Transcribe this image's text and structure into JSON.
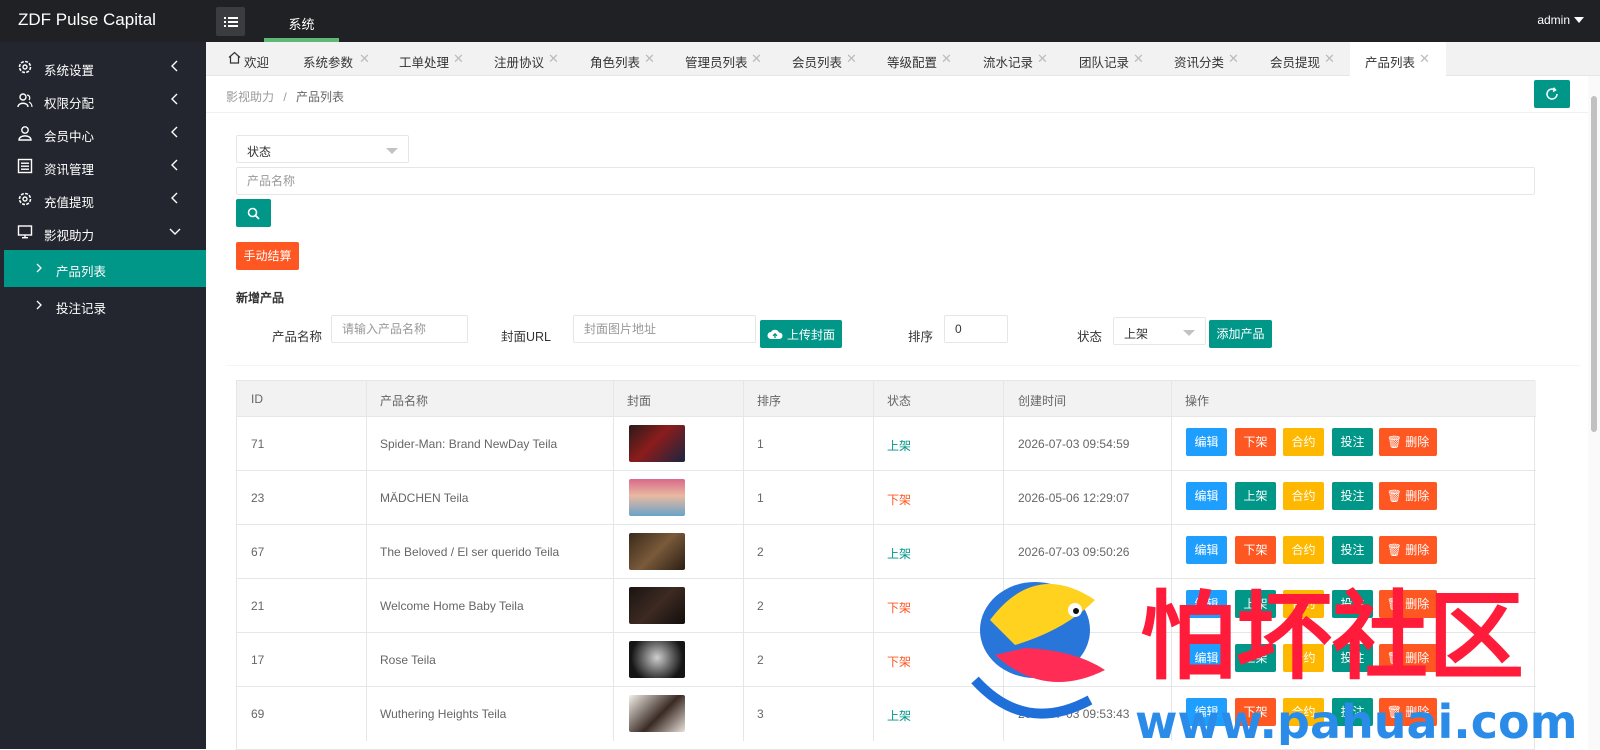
{
  "app": {
    "brand": "ZDF Pulse Capital",
    "top_tab": "系统",
    "user": "admin"
  },
  "sidebar": {
    "items": [
      {
        "label": "系统设置",
        "icon": "gear-icon"
      },
      {
        "label": "权限分配",
        "icon": "users-icon"
      },
      {
        "label": "会员中心",
        "icon": "user-icon"
      },
      {
        "label": "资讯管理",
        "icon": "list-icon"
      },
      {
        "label": "充值提现",
        "icon": "gear-icon"
      },
      {
        "label": "影视助力",
        "icon": "monitor-icon"
      }
    ],
    "sub_items": [
      {
        "label": "产品列表",
        "active": true
      },
      {
        "label": "投注记录",
        "active": false
      }
    ]
  },
  "tabs": [
    "欢迎",
    "系统参数",
    "工单处理",
    "注册协议",
    "角色列表",
    "管理员列表",
    "会员列表",
    "等级配置",
    "流水记录",
    "团队记录",
    "资讯分类",
    "会员提现",
    "产品列表"
  ],
  "breadcrumb": {
    "parent": "影视助力",
    "sep": "/",
    "current": "产品列表"
  },
  "filters": {
    "status_label": "状态",
    "name_placeholder": "产品名称",
    "settle_label": "手动结算"
  },
  "add_form": {
    "title": "新增产品",
    "name_label": "产品名称",
    "name_placeholder": "请输入产品名称",
    "cover_label": "封面URL",
    "cover_placeholder": "封面图片地址",
    "upload_label": "上传封面",
    "sort_label": "排序",
    "sort_value": "0",
    "status_label": "状态",
    "status_value": "上架",
    "add_label": "添加产品"
  },
  "table": {
    "headers": [
      "ID",
      "产品名称",
      "封面",
      "排序",
      "状态",
      "创建时间",
      "操作"
    ],
    "rows": [
      {
        "id": "71",
        "name": "Spider-Man: Brand NewDay Teila",
        "sort": "1",
        "status": "上架",
        "created": "2026-07-03 09:54:59",
        "toggle": "下架"
      },
      {
        "id": "23",
        "name": "MÄDCHEN Teila",
        "sort": "1",
        "status": "下架",
        "created": "2026-05-06 12:29:07",
        "toggle": "上架"
      },
      {
        "id": "67",
        "name": "The Beloved / El ser querido Teila",
        "sort": "2",
        "status": "上架",
        "created": "2026-07-03 09:50:26",
        "toggle": "下架"
      },
      {
        "id": "21",
        "name": "Welcome Home Baby Teila",
        "sort": "2",
        "status": "下架",
        "created": "",
        "toggle": "上架"
      },
      {
        "id": "17",
        "name": "Rose Teila",
        "sort": "2",
        "status": "下架",
        "created": "20... 09",
        "toggle": "上架"
      },
      {
        "id": "69",
        "name": "Wuthering Heights Teila",
        "sort": "3",
        "status": "上架",
        "created": "2026-07-03 09:53:43",
        "toggle": "下架"
      }
    ],
    "actions": {
      "edit": "编辑",
      "contract": "合约",
      "bet": "投注",
      "delete": "删除"
    }
  },
  "watermark": {
    "title": "怕坏社区",
    "url": "www.pahuai.com"
  },
  "colors": {
    "primary": "#009688",
    "danger": "#ff5722",
    "info": "#1e9fff",
    "warn": "#ffb800",
    "sidebar": "#23262e",
    "topbar": "#1f2124"
  }
}
